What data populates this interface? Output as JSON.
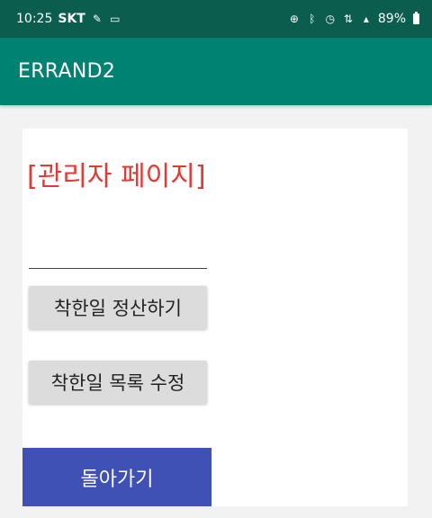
{
  "status_bar": {
    "time": "10:25",
    "carrier": "SKT",
    "battery": "89%",
    "icons": [
      "pen-icon",
      "gallery-icon",
      "location-icon",
      "bluetooth-icon",
      "alarm-icon",
      "data-icon",
      "signal-icon",
      "battery-icon"
    ]
  },
  "app_bar": {
    "title": "ERRAND2"
  },
  "content": {
    "admin_title": "[관리자 페이지]",
    "edit_text_value": "",
    "settle_button_label": "착한일 정산하기",
    "edit_list_button_label": "착한일 목록 수정",
    "back_button_label": "돌아가기"
  },
  "colors": {
    "status_bar": "#0b5d4e",
    "app_bar": "#008272",
    "admin_title": "#e53935",
    "back_button": "#3f51b5",
    "gray_button": "#dcdcdc"
  }
}
